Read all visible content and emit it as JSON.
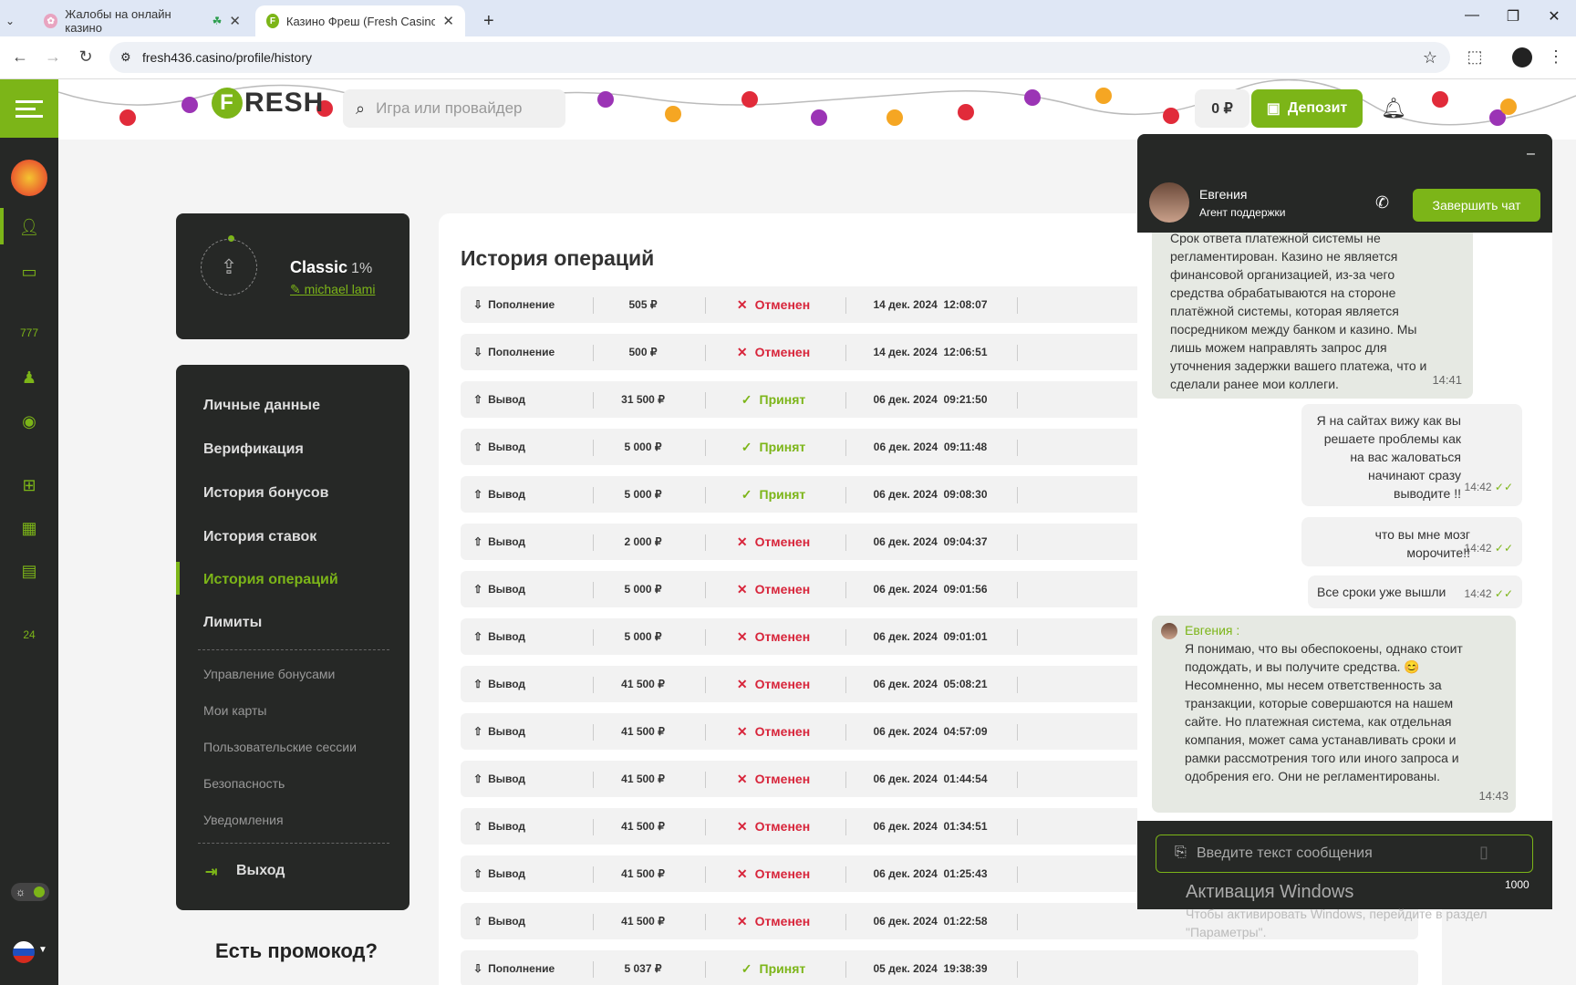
{
  "browser": {
    "tabs": [
      {
        "title": "Жалобы на онлайн казино"
      },
      {
        "title": "Казино Фреш (Fresh Casino) - с"
      }
    ],
    "new_tab": "+",
    "url": "fresh436.casino/profile/history"
  },
  "header": {
    "logo": "RESH",
    "logo_f": "F",
    "search_placeholder": "Игра или провайдер",
    "balance": "0 ₽",
    "deposit_label": "Депозит"
  },
  "profile": {
    "level": "Classic",
    "level_pct": "1%",
    "username": "michael lami"
  },
  "menu": {
    "main": [
      "Личные данные",
      "Верификация",
      "История бонусов",
      "История ставок",
      "История операций",
      "Лимиты"
    ],
    "sub": [
      "Управление бонусами",
      "Мои карты",
      "Пользовательские сессии",
      "Безопасность",
      "Уведомления"
    ],
    "logout": "Выход",
    "promo": "Есть промокод?"
  },
  "history": {
    "title": "История операций",
    "rows": [
      {
        "type": "Пополнение",
        "amount": "505 ₽",
        "status": "Отменен",
        "ok": false,
        "date": "14 дек. 2024",
        "time": "12:08:07"
      },
      {
        "type": "Пополнение",
        "amount": "500 ₽",
        "status": "Отменен",
        "ok": false,
        "date": "14 дек. 2024",
        "time": "12:06:51"
      },
      {
        "type": "Вывод",
        "amount": "31 500 ₽",
        "status": "Принят",
        "ok": true,
        "date": "06 дек. 2024",
        "time": "09:21:50"
      },
      {
        "type": "Вывод",
        "amount": "5 000 ₽",
        "status": "Принят",
        "ok": true,
        "date": "06 дек. 2024",
        "time": "09:11:48"
      },
      {
        "type": "Вывод",
        "amount": "5 000 ₽",
        "status": "Принят",
        "ok": true,
        "date": "06 дек. 2024",
        "time": "09:08:30"
      },
      {
        "type": "Вывод",
        "amount": "2 000 ₽",
        "status": "Отменен",
        "ok": false,
        "date": "06 дек. 2024",
        "time": "09:04:37"
      },
      {
        "type": "Вывод",
        "amount": "5 000 ₽",
        "status": "Отменен",
        "ok": false,
        "date": "06 дек. 2024",
        "time": "09:01:56"
      },
      {
        "type": "Вывод",
        "amount": "5 000 ₽",
        "status": "Отменен",
        "ok": false,
        "date": "06 дек. 2024",
        "time": "09:01:01"
      },
      {
        "type": "Вывод",
        "amount": "41 500 ₽",
        "status": "Отменен",
        "ok": false,
        "date": "06 дек. 2024",
        "time": "05:08:21"
      },
      {
        "type": "Вывод",
        "amount": "41 500 ₽",
        "status": "Отменен",
        "ok": false,
        "date": "06 дек. 2024",
        "time": "04:57:09"
      },
      {
        "type": "Вывод",
        "amount": "41 500 ₽",
        "status": "Отменен",
        "ok": false,
        "date": "06 дек. 2024",
        "time": "01:44:54"
      },
      {
        "type": "Вывод",
        "amount": "41 500 ₽",
        "status": "Отменен",
        "ok": false,
        "date": "06 дек. 2024",
        "time": "01:34:51"
      },
      {
        "type": "Вывод",
        "amount": "41 500 ₽",
        "status": "Отменен",
        "ok": false,
        "date": "06 дек. 2024",
        "time": "01:25:43"
      },
      {
        "type": "Вывод",
        "amount": "41 500 ₽",
        "status": "Отменен",
        "ok": false,
        "date": "06 дек. 2024",
        "time": "01:22:58"
      },
      {
        "type": "Пополнение",
        "amount": "5 037 ₽",
        "status": "Принят",
        "ok": true,
        "date": "05 дек. 2024",
        "time": "19:38:39"
      }
    ]
  },
  "chat": {
    "agent_name": "Евгения",
    "agent_role": "Агент поддержки",
    "end_chat": "Завершить чат",
    "minimize": "–",
    "messages": [
      {
        "dir": "in",
        "text": "Срок ответа платежной системы не регламентирован. Казино не является финансовой организацией, из-за чего средства обрабатываются на стороне платёжной системы, которая является посредником между банком и казино. Мы лишь можем направлять запрос для уточнения задержки вашего платежа, что и сделали ранее мои коллеги.",
        "time": "14:41"
      },
      {
        "dir": "out",
        "text": "Я на сайтах вижу как вы решаете проблемы как на вас жаловаться начинают сразу выводите !!",
        "time": "14:42"
      },
      {
        "dir": "out",
        "text": "что вы мне мозг морочите!!",
        "time": "14:42"
      },
      {
        "dir": "out",
        "text": "Все сроки уже вышли",
        "time": "14:42"
      },
      {
        "dir": "in",
        "sender": "Евгения :",
        "text": "Я понимаю, что вы обеспокоены, однако стоит подождать, и вы получите средства. 😊 Несомненно, мы несем ответственность за транзакции, которые совершаются на нашем сайте. Но платежная система, как отдельная компания, может сама устанавливать сроки и рамки рассмотрения того или иного запроса и одобрения его. Они не регламентированы.",
        "time": "14:43"
      }
    ],
    "input_placeholder": "Введите текст сообщения",
    "counter": "1000"
  },
  "os": {
    "watermark_title": "Активация Windows",
    "watermark_text": "Чтобы активировать Windows, перейдите в раздел \"Параметры\"."
  },
  "colors": {
    "brand": "#7cb518",
    "dark": "#262826",
    "cancel": "#d8253b"
  }
}
